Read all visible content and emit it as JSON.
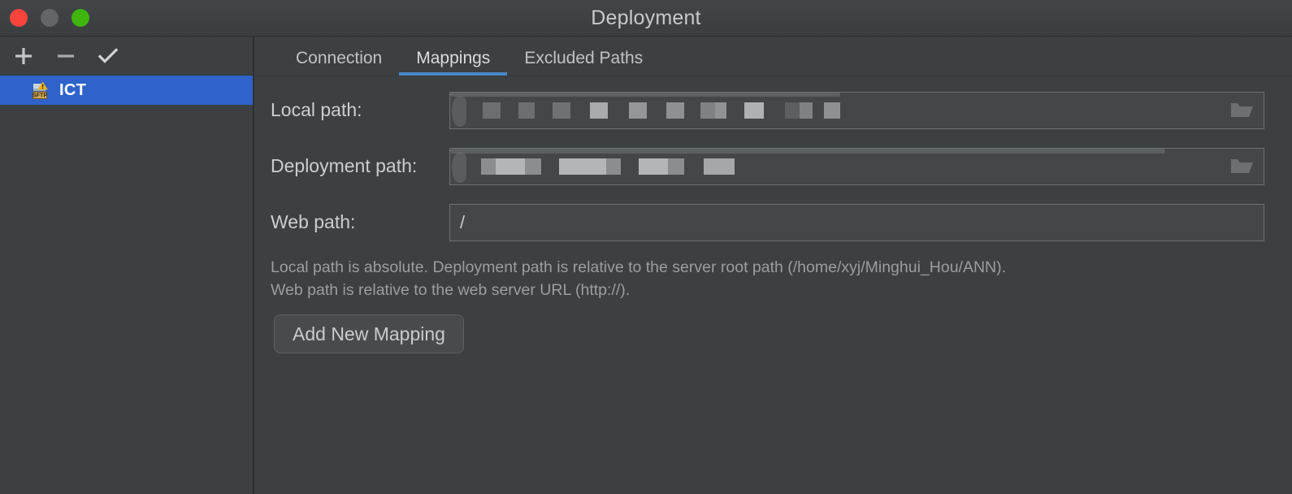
{
  "window": {
    "title": "Deployment",
    "traffic_lights": [
      {
        "name": "close",
        "color": "#f9443c"
      },
      {
        "name": "minimize",
        "color": "#636667"
      },
      {
        "name": "maximize",
        "color": "#3fb50e"
      }
    ]
  },
  "sidebar": {
    "toolbar": [
      {
        "icon": "plus-icon",
        "label": "Add"
      },
      {
        "icon": "minus-icon",
        "label": "Remove"
      },
      {
        "icon": "check-icon",
        "label": "Set as default"
      }
    ],
    "servers": [
      {
        "label": "ICT",
        "icon": "sftp-server-icon",
        "badge": "SFTP",
        "selected": true
      }
    ],
    "selection_color": "#2f63c9"
  },
  "main": {
    "tabs": [
      {
        "label": "Connection",
        "active": false
      },
      {
        "label": "Mappings",
        "active": true
      },
      {
        "label": "Excluded Paths",
        "active": false
      }
    ],
    "accent_color": "#4a88c7",
    "fields": [
      {
        "label": "Local path:",
        "value": "",
        "redacted": true,
        "browse_icon": "folder-icon"
      },
      {
        "label": "Deployment path:",
        "value": "",
        "redacted": true,
        "browse_icon": "folder-icon"
      },
      {
        "label": "Web path:",
        "value": "/",
        "redacted": false,
        "browse_icon": ""
      }
    ],
    "hint_line_1": "Local path is absolute. Deployment path is relative to the server root path (/home/xyj/Minghui_Hou/ANN).",
    "hint_line_2": "Web path is relative to the web server URL (http://).",
    "add_mapping_label": "Add New Mapping"
  }
}
